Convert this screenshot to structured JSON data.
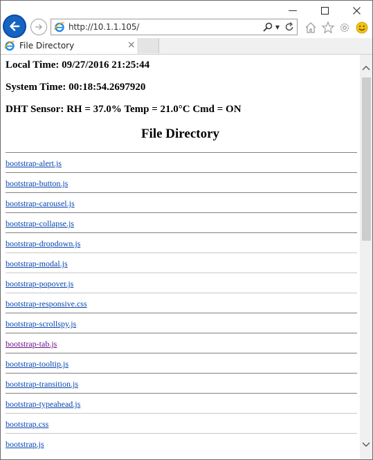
{
  "window": {
    "minimize_glyph": "—",
    "maximize_glyph": "☐",
    "close_glyph": "✕"
  },
  "navigation": {
    "back_icon": "back-arrow-icon",
    "forward_icon": "forward-arrow-icon",
    "address_url": "http://10.1.1.105/",
    "search_icon": "search-icon",
    "dropdown_icon": "chevron-down-icon",
    "refresh_icon": "refresh-icon"
  },
  "toolbar": {
    "icons": [
      "home-icon",
      "favorites-star-icon",
      "settings-gear-icon",
      "feedback-smiley-icon"
    ]
  },
  "tab": {
    "title": "File Directory",
    "close_glyph": "×"
  },
  "page": {
    "local_time": "Local Time: 09/27/2016 21:25:44",
    "system_time": "System Time: 00:18:54.2697920",
    "sensor": "DHT Sensor: RH = 37.0% Temp = 21.0°C Cmd = ON",
    "heading": "File Directory"
  },
  "files": [
    {
      "name": "bootstrap-alert.js"
    },
    {
      "name": "bootstrap-button.js"
    },
    {
      "name": "bootstrap-carousel.js"
    },
    {
      "name": "bootstrap-collapse.js"
    },
    {
      "name": "bootstrap-dropdown.js"
    },
    {
      "name": "bootstrap-modal.js"
    },
    {
      "name": "bootstrap-popover.js"
    },
    {
      "name": "bootstrap-responsive.css"
    },
    {
      "name": "bootstrap-scrollspy.js"
    },
    {
      "name": "bootstrap-tab.js",
      "visited": true
    },
    {
      "name": "bootstrap-tooltip.js"
    },
    {
      "name": "bootstrap-transition.js"
    },
    {
      "name": "bootstrap-typeahead.js"
    },
    {
      "name": "bootstrap.css"
    },
    {
      "name": "bootstrap.js"
    }
  ],
  "colors": {
    "link": "#0645ad",
    "visited_link": "#6a0f8e",
    "back_button": "#1565c0",
    "ie_blue": "#1e88e5",
    "smiley": "#f4c20d"
  }
}
